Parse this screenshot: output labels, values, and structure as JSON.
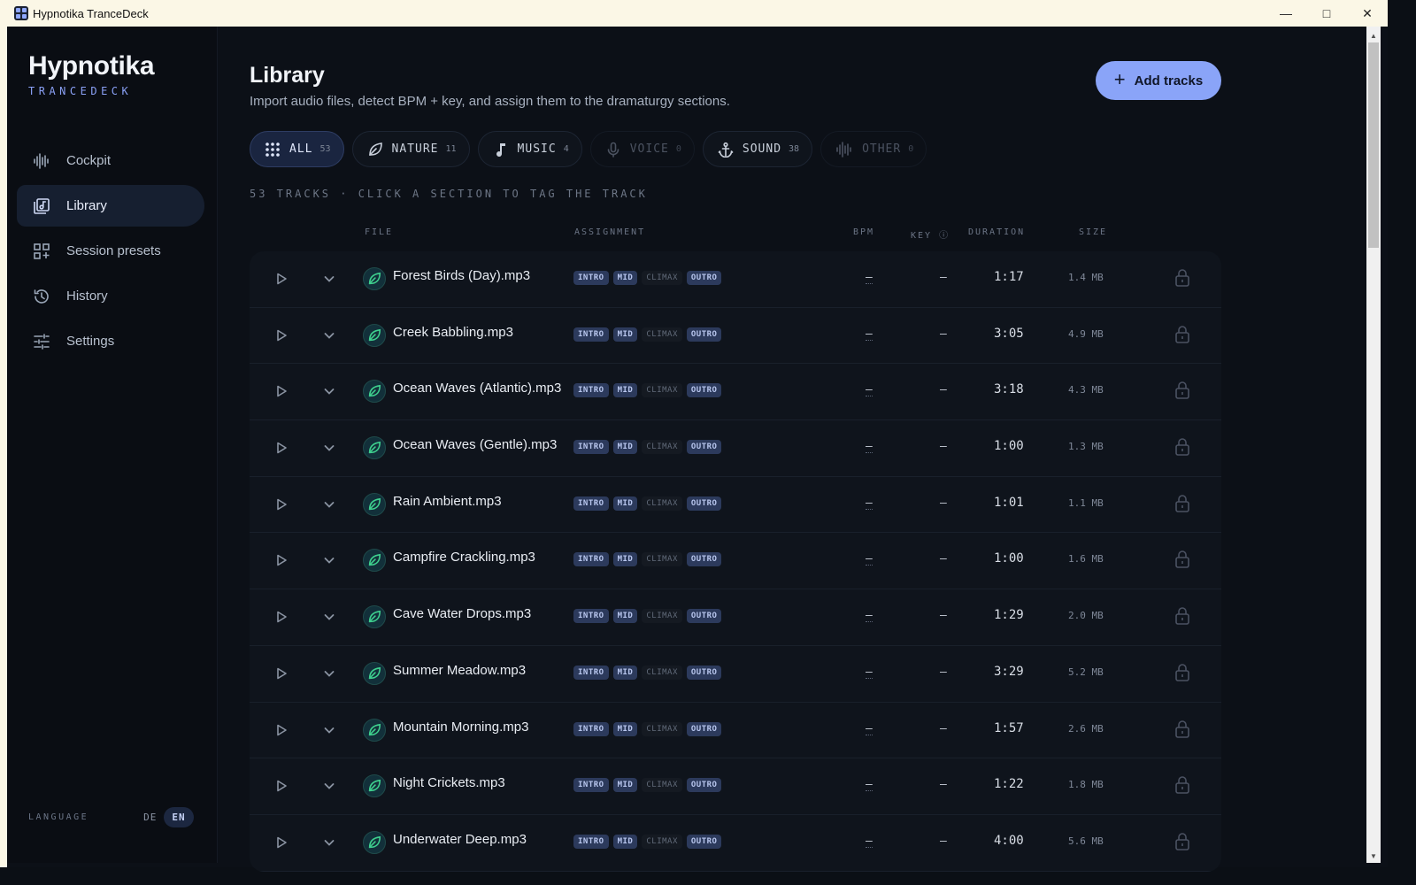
{
  "window": {
    "title": "Hypnotika TranceDeck"
  },
  "brand": {
    "name": "Hypnotika",
    "sub": "TRANCEDECK"
  },
  "nav": [
    {
      "label": "Cockpit",
      "icon": "waveform-icon",
      "active": false
    },
    {
      "label": "Library",
      "icon": "library-icon",
      "active": true
    },
    {
      "label": "Session presets",
      "icon": "grid-plus-icon",
      "active": false
    },
    {
      "label": "History",
      "icon": "history-icon",
      "active": false
    },
    {
      "label": "Settings",
      "icon": "sliders-icon",
      "active": false
    }
  ],
  "language": {
    "label": "LANGUAGE",
    "options": [
      "DE",
      "EN"
    ],
    "selected": "EN"
  },
  "header": {
    "title": "Library",
    "subtitle": "Import audio files, detect BPM + key, and assign them to the dramaturgy sections.",
    "add_label": "Add tracks"
  },
  "filters": [
    {
      "label": "ALL",
      "count": "53",
      "icon": "dots-grid-icon",
      "state": "active"
    },
    {
      "label": "NATURE",
      "count": "11",
      "icon": "leaf-icon",
      "state": "normal"
    },
    {
      "label": "MUSIC",
      "count": "4",
      "icon": "music-note-icon",
      "state": "normal"
    },
    {
      "label": "VOICE",
      "count": "0",
      "icon": "microphone-icon",
      "state": "dim"
    },
    {
      "label": "SOUND",
      "count": "38",
      "icon": "anchor-icon",
      "state": "normal"
    },
    {
      "label": "OTHER",
      "count": "0",
      "icon": "waveform-icon",
      "state": "dim"
    }
  ],
  "count_line": "53 TRACKS · CLICK A SECTION TO TAG THE TRACK",
  "columns": {
    "file": "FILE",
    "assignment": "ASSIGNMENT",
    "bpm": "BPM",
    "key": "KEY",
    "duration": "DURATION",
    "size": "SIZE"
  },
  "sections": [
    "INTRO",
    "MID",
    "CLIMAX",
    "OUTRO"
  ],
  "tracks": [
    {
      "file": "Forest Birds (Day).mp3",
      "bpm": "–",
      "key": "–",
      "duration": "1:17",
      "size": "1.4 MB",
      "tags": [
        true,
        true,
        false,
        true
      ]
    },
    {
      "file": "Creek Babbling.mp3",
      "bpm": "–",
      "key": "–",
      "duration": "3:05",
      "size": "4.9 MB",
      "tags": [
        true,
        true,
        false,
        true
      ]
    },
    {
      "file": "Ocean Waves (Atlantic).mp3",
      "bpm": "–",
      "key": "–",
      "duration": "3:18",
      "size": "4.3 MB",
      "tags": [
        true,
        true,
        false,
        true
      ]
    },
    {
      "file": "Ocean Waves (Gentle).mp3",
      "bpm": "–",
      "key": "–",
      "duration": "1:00",
      "size": "1.3 MB",
      "tags": [
        true,
        true,
        false,
        true
      ]
    },
    {
      "file": "Rain Ambient.mp3",
      "bpm": "–",
      "key": "–",
      "duration": "1:01",
      "size": "1.1 MB",
      "tags": [
        true,
        true,
        false,
        true
      ]
    },
    {
      "file": "Campfire Crackling.mp3",
      "bpm": "–",
      "key": "–",
      "duration": "1:00",
      "size": "1.6 MB",
      "tags": [
        true,
        true,
        false,
        true
      ]
    },
    {
      "file": "Cave Water Drops.mp3",
      "bpm": "–",
      "key": "–",
      "duration": "1:29",
      "size": "2.0 MB",
      "tags": [
        true,
        true,
        false,
        true
      ]
    },
    {
      "file": "Summer Meadow.mp3",
      "bpm": "–",
      "key": "–",
      "duration": "3:29",
      "size": "5.2 MB",
      "tags": [
        true,
        true,
        false,
        true
      ]
    },
    {
      "file": "Mountain Morning.mp3",
      "bpm": "–",
      "key": "–",
      "duration": "1:57",
      "size": "2.6 MB",
      "tags": [
        true,
        true,
        false,
        true
      ]
    },
    {
      "file": "Night Crickets.mp3",
      "bpm": "–",
      "key": "–",
      "duration": "1:22",
      "size": "1.8 MB",
      "tags": [
        true,
        true,
        false,
        true
      ]
    },
    {
      "file": "Underwater Deep.mp3",
      "bpm": "–",
      "key": "–",
      "duration": "4:00",
      "size": "5.6 MB",
      "tags": [
        true,
        true,
        false,
        true
      ]
    }
  ],
  "colors": {
    "accent": "#8aa4f8",
    "background": "#0c1017",
    "nature": "#3ecf8e"
  }
}
